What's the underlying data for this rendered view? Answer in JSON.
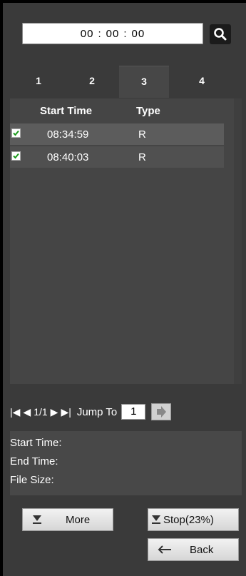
{
  "time": {
    "hh": "00",
    "mm": "00",
    "ss": "00",
    "sep": ":"
  },
  "tabs": [
    {
      "label": "1"
    },
    {
      "label": "2"
    },
    {
      "label": "3"
    },
    {
      "label": "4"
    }
  ],
  "list": {
    "headers": {
      "start_time": "Start Time",
      "type": "Type"
    },
    "rows": [
      {
        "time": "08:34:59",
        "type": "R",
        "checked": true
      },
      {
        "time": "08:40:03",
        "type": "R",
        "checked": true
      }
    ]
  },
  "pager": {
    "page_text": "1/1",
    "jump_label": "Jump To",
    "page_value": "1"
  },
  "info": {
    "start_time": "Start Time:",
    "end_time": "End Time:",
    "file_size": "File Size:"
  },
  "buttons": {
    "more": "More",
    "stop": "Stop(23%)",
    "back": "Back"
  }
}
